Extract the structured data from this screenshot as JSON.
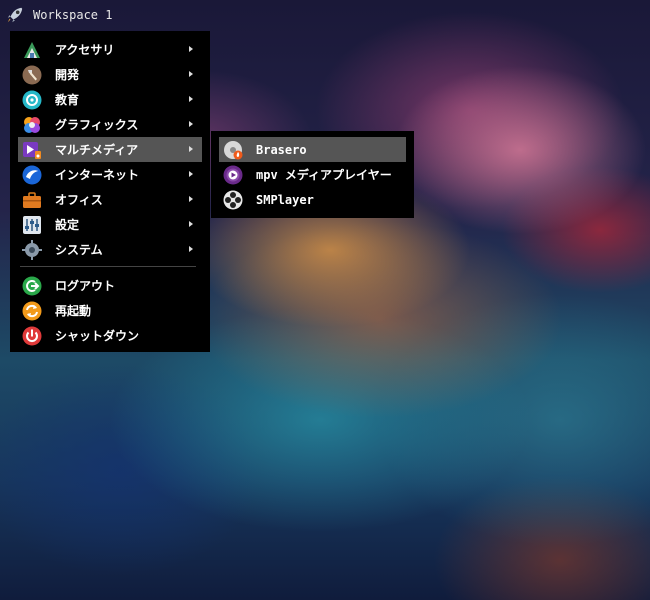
{
  "topbar": {
    "workspace": "Workspace 1"
  },
  "menu": {
    "items": [
      {
        "label": "アクセサリ",
        "icon": "accessories-icon",
        "submenu": true
      },
      {
        "label": "開発",
        "icon": "hammer-icon",
        "submenu": true
      },
      {
        "label": "教育",
        "icon": "education-icon",
        "submenu": true
      },
      {
        "label": "グラフィックス",
        "icon": "graphics-icon",
        "submenu": true
      },
      {
        "label": "マルチメディア",
        "icon": "multimedia-icon",
        "submenu": true
      },
      {
        "label": "インターネット",
        "icon": "internet-icon",
        "submenu": true
      },
      {
        "label": "オフィス",
        "icon": "office-icon",
        "submenu": true
      },
      {
        "label": "設定",
        "icon": "settings-icon",
        "submenu": true
      },
      {
        "label": "システム",
        "icon": "system-icon",
        "submenu": true
      }
    ],
    "actions": [
      {
        "label": "ログアウト",
        "icon": "logout-icon"
      },
      {
        "label": "再起動",
        "icon": "reboot-icon"
      },
      {
        "label": "シャットダウン",
        "icon": "shutdown-icon"
      }
    ]
  },
  "submenu": {
    "items": [
      {
        "label": "Brasero",
        "icon": "brasero-icon"
      },
      {
        "label": "mpv メディアプレイヤー",
        "icon": "mpv-icon"
      },
      {
        "label": "SMPlayer",
        "icon": "smplayer-icon"
      }
    ]
  }
}
